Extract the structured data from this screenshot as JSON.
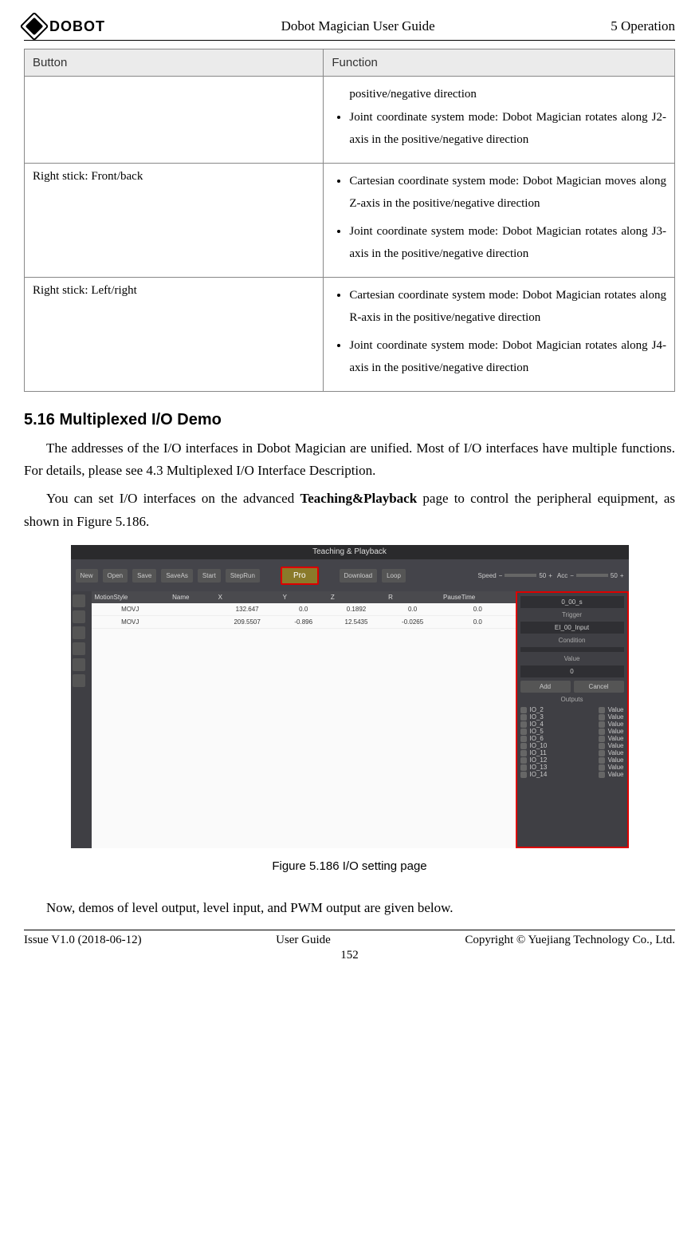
{
  "header": {
    "logo_text": "DOBOT",
    "center": "Dobot Magician User Guide",
    "right": "5 Operation"
  },
  "table": {
    "head": {
      "col1": "Button",
      "col2": "Function"
    },
    "rows": [
      {
        "button": "",
        "funcs": [
          "positive/negative direction",
          "Joint coordinate system mode: Dobot Magician rotates along J2-axis in the positive/negative direction"
        ]
      },
      {
        "button": "Right stick: Front/back",
        "funcs": [
          "Cartesian coordinate system mode: Dobot Magician moves along Z-axis in the positive/negative direction",
          "Joint coordinate system mode: Dobot Magician rotates along J3-axis in the positive/negative direction"
        ]
      },
      {
        "button": "Right stick: Left/right",
        "funcs": [
          "Cartesian coordinate system mode: Dobot Magician rotates along R-axis in the positive/negative direction",
          "Joint coordinate system mode: Dobot Magician rotates along J4-axis in the positive/negative direction"
        ]
      }
    ]
  },
  "section": {
    "heading": "5.16  Multiplexed I/O Demo",
    "p1": "The addresses of the I/O interfaces in Dobot Magician are unified. Most of I/O interfaces have multiple functions. For details, please see 4.3 Multiplexed I/O Interface Description.",
    "p2a": "You can set I/O interfaces on the advanced ",
    "p2b": "Teaching&Playback",
    "p2c": " page to control the peripheral equipment, as shown in Figure 5.186."
  },
  "screenshot": {
    "title": "Teaching & Playback",
    "toolbar": [
      "New",
      "Open",
      "Save",
      "SaveAs",
      "Start",
      "StepRun",
      "Download",
      "Loop"
    ],
    "pro": "Pro",
    "speed_label": "Speed",
    "speed_value": "50",
    "acc_label": "Acc",
    "acc_value": "50",
    "cols": [
      "MotionStyle",
      "Name",
      "X",
      "Y",
      "Z",
      "R",
      "PauseTime"
    ],
    "data_rows": [
      [
        "MOVJ",
        "",
        "132.647",
        "0.0",
        "0.1892",
        "0.0",
        "0.0"
      ],
      [
        "MOVJ",
        "",
        "209.5507",
        "-0.896",
        "12.5435",
        "-0.0265",
        "0.0"
      ]
    ],
    "right": {
      "timer": "0_00_s",
      "trigger_label": "Trigger",
      "trigger_value": "EI_00_Input",
      "condition_label": "Condition",
      "value_label": "Value",
      "value": "0",
      "add": "Add",
      "cancel": "Cancel",
      "outputs_label": "Outputs",
      "ios": [
        "IO_2",
        "IO_3",
        "IO_4",
        "IO_5",
        "IO_6",
        "IO_10",
        "IO_11",
        "IO_12",
        "IO_13",
        "IO_14"
      ],
      "value_col": "Value"
    }
  },
  "fig_caption": "Figure 5.186    I/O setting page",
  "after_fig": "Now, demos of level output, level input, and PWM output are given below.",
  "footer": {
    "left": "Issue V1.0 (2018-06-12)",
    "center": "User Guide",
    "right": "Copyright © Yuejiang Technology Co., Ltd.",
    "page": "152"
  }
}
